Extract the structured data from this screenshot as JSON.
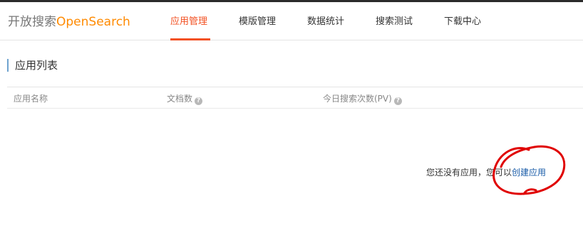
{
  "brand": {
    "name_cn": "开放搜索",
    "name_en": "OpenSearch"
  },
  "nav": {
    "items": [
      {
        "label": "应用管理",
        "active": true
      },
      {
        "label": "模版管理",
        "active": false
      },
      {
        "label": "数据统计",
        "active": false
      },
      {
        "label": "搜索测试",
        "active": false
      },
      {
        "label": "下载中心",
        "active": false
      }
    ]
  },
  "section": {
    "title": "应用列表"
  },
  "table": {
    "columns": [
      {
        "label": "应用名称",
        "has_info": false
      },
      {
        "label": "文档数",
        "has_info": true
      },
      {
        "label": "今日搜索次数(PV)",
        "has_info": true
      }
    ]
  },
  "empty_state": {
    "text": "您还没有应用，您可以",
    "link_label": "创建应用"
  },
  "colors": {
    "accent": "#f25022",
    "brand_en": "#ff8a00",
    "link": "#1a5ca8",
    "annotation": "#e00000"
  }
}
